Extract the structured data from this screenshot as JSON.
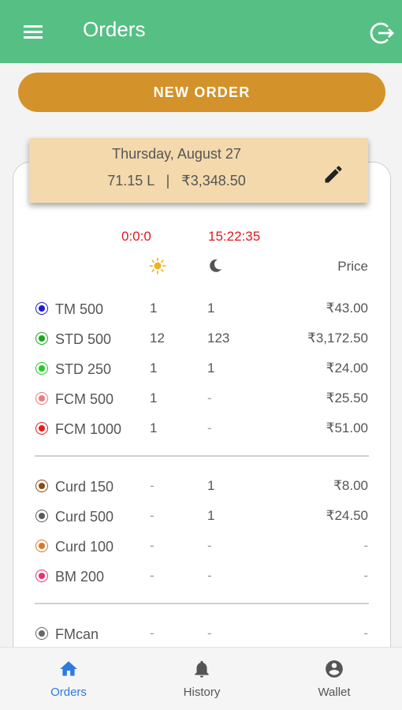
{
  "appbar": {
    "title": "Orders",
    "menu_icon": "menu-icon",
    "logout_icon": "logout-icon"
  },
  "new_order_label": "NEW ORDER",
  "order": {
    "date": "Thursday, August 27",
    "summary": "71.15 L   |   ₹3,348.50",
    "edit_icon": "pencil-icon"
  },
  "table": {
    "morning_timer": "0:0:0",
    "evening_timer": "15:22:35",
    "morning_icon": "sun-icon",
    "evening_icon": "moon-icon",
    "price_header": "Price",
    "groups": [
      [
        {
          "name": "TM 500",
          "morning": "1",
          "evening": "1",
          "price": "₹43.00",
          "color": "#1a1ad6"
        },
        {
          "name": "STD 500",
          "morning": "12",
          "evening": "123",
          "price": "₹3,172.50",
          "color": "#18a818"
        },
        {
          "name": "STD 250",
          "morning": "1",
          "evening": "1",
          "price": "₹24.00",
          "color": "#22cc22"
        },
        {
          "name": "FCM 500",
          "morning": "1",
          "evening": "-",
          "price": "₹25.50",
          "color": "#f07878"
        },
        {
          "name": "FCM 1000",
          "morning": "1",
          "evening": "-",
          "price": "₹51.00",
          "color": "#e51c1c"
        }
      ],
      [
        {
          "name": "Curd 150",
          "morning": "-",
          "evening": "1",
          "price": "₹8.00",
          "color": "#8a4a14"
        },
        {
          "name": "Curd 500",
          "morning": "-",
          "evening": "1",
          "price": "₹24.50",
          "color": "#5a5a5a"
        },
        {
          "name": "Curd 100",
          "morning": "-",
          "evening": "-",
          "price": "-",
          "color": "#d8782a"
        },
        {
          "name": "BM 200",
          "morning": "-",
          "evening": "-",
          "price": "-",
          "color": "#e2336b"
        }
      ],
      [
        {
          "name": "FMcan",
          "morning": "-",
          "evening": "-",
          "price": "-",
          "color": "#666666"
        }
      ]
    ]
  },
  "bottom_nav": [
    {
      "label": "Orders",
      "icon": "home-icon",
      "active": true
    },
    {
      "label": "History",
      "icon": "bell-icon",
      "active": false
    },
    {
      "label": "Wallet",
      "icon": "account-icon",
      "active": false
    }
  ],
  "colors": {
    "appbar": "#56bf84",
    "accent": "#d4922a",
    "active_nav": "#2f7ae0",
    "timer": "#e0191d"
  }
}
